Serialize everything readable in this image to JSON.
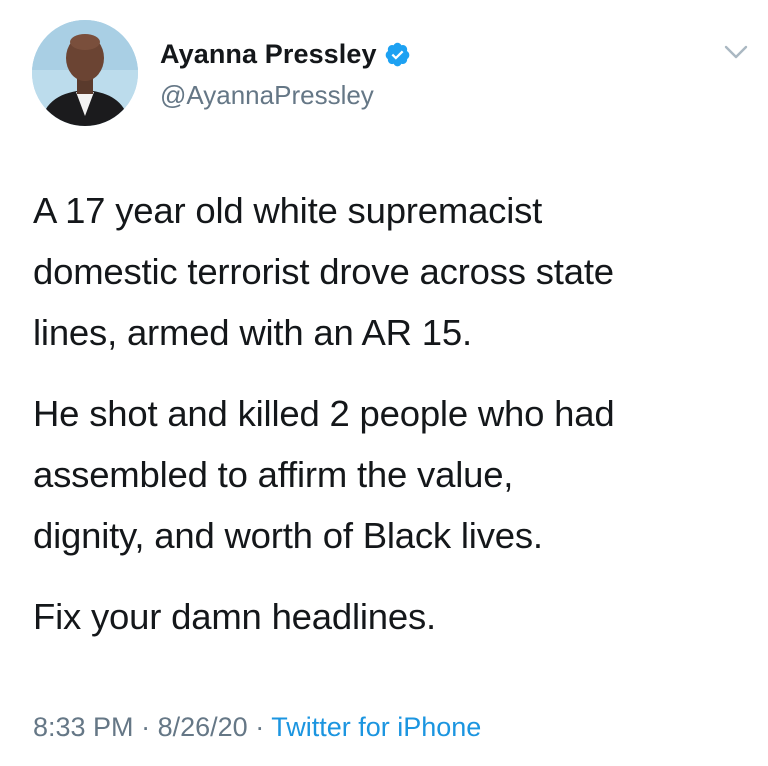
{
  "author": {
    "display_name": "Ayanna Pressley",
    "handle": "@AyannaPressley",
    "verified": true,
    "avatar_icon": "profile-photo"
  },
  "tweet": {
    "paragraphs": [
      "A 17 year old white supremacist\ndomestic terrorist drove across state\nlines, armed with an AR 15.",
      "He shot and killed 2 people who had\nassembled to affirm the value,\ndignity, and worth of Black lives.",
      "Fix your damn headlines."
    ],
    "time": "8:33 PM",
    "separator": "·",
    "date": "8/26/20",
    "source": "Twitter for iPhone"
  },
  "colors": {
    "text": "#14171a",
    "secondary": "#657786",
    "link": "#1b95e0",
    "verified": "#1da1f2"
  },
  "icons": {
    "menu": "chevron-down-icon",
    "verified": "verified-badge-icon"
  }
}
